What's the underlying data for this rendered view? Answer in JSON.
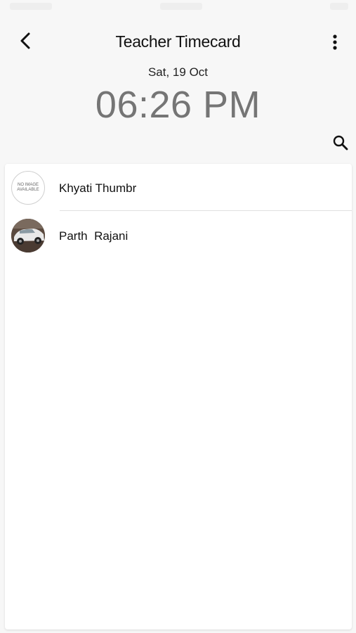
{
  "header": {
    "title": "Teacher Timecard",
    "back_icon": "chevron-left-icon",
    "menu_icon": "more-vertical-icon"
  },
  "clock": {
    "date": "Sat, 19 Oct",
    "time": "06:26 PM"
  },
  "search": {
    "icon": "search-icon"
  },
  "teachers": [
    {
      "name": "Khyati Thumbr",
      "avatar": "no-image",
      "avatar_text": "NO IMAGE AVAILABLE"
    },
    {
      "name": "Parth  Rajani",
      "avatar": "photo"
    }
  ],
  "colors": {
    "background": "#f7f7f7",
    "card": "#ffffff",
    "time_text": "#757575",
    "divider": "#e0e0e0"
  }
}
